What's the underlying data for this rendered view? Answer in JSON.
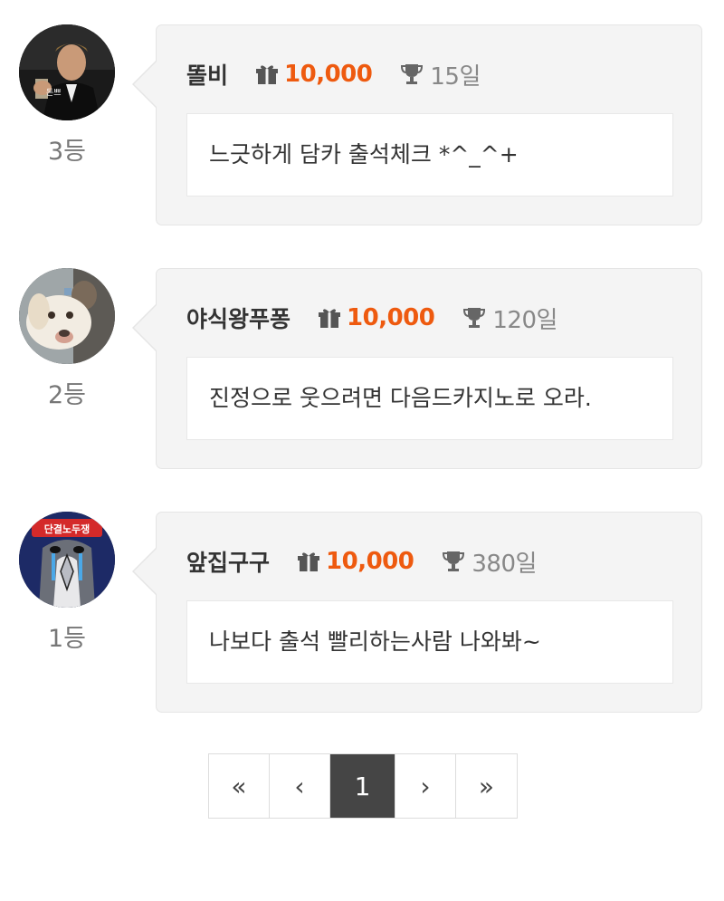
{
  "entries": [
    {
      "rank": "3등",
      "nickname": "똘비",
      "points": "10,000",
      "days": "15일",
      "comment": "느긋하게 담카 출석체크 *^_^+",
      "avatar_icon": "man-raising-glass-photo"
    },
    {
      "rank": "2등",
      "nickname": "야식왕푸퐁",
      "points": "10,000",
      "days": "120일",
      "comment": "진정으로 웃으려면 다음드카지노로 오라.",
      "avatar_icon": "white-dog-photo"
    },
    {
      "rank": "1등",
      "nickname": "앞집구구",
      "points": "10,000",
      "days": "380일",
      "comment": "나보다 출석 빨리하는사람 나와봐~",
      "avatar_icon": "crying-penguin-cartoon"
    }
  ],
  "pagination": {
    "first": "«",
    "prev": "‹",
    "current": "1",
    "next": "›",
    "last": "»"
  },
  "colors": {
    "points": "#ee5a0f",
    "card_bg": "#f4f4f4",
    "active_page_bg": "#454545"
  },
  "icons": {
    "gift": "gift-icon",
    "trophy": "trophy-icon"
  }
}
